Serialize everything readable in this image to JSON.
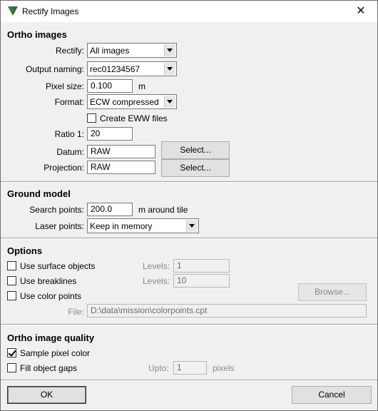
{
  "window": {
    "title": "Rectify Images",
    "close_icon": "close-icon"
  },
  "ortho": {
    "heading": "Ortho images",
    "rectify_label": "Rectify:",
    "rectify_value": "All images",
    "output_naming_label": "Output naming:",
    "output_naming_value": "rec01234567",
    "pixel_size_label": "Pixel size:",
    "pixel_size_value": "0.100",
    "pixel_size_unit": "m",
    "format_label": "Format:",
    "format_value": "ECW compressed",
    "create_eww_label": "Create EWW files",
    "create_eww_checked": false,
    "ratio_label": "Ratio 1:",
    "ratio_value": "20",
    "datum_label": "Datum:",
    "datum_value": "RAW",
    "datum_button": "Select...",
    "projection_label": "Projection:",
    "projection_value": "RAW",
    "projection_button": "Select..."
  },
  "ground": {
    "heading": "Ground model",
    "search_points_label": "Search points:",
    "search_points_value": "200.0",
    "search_points_unit": "m around tile",
    "laser_points_label": "Laser points:",
    "laser_points_value": "Keep in memory"
  },
  "options": {
    "heading": "Options",
    "surface_objects_label": "Use surface objects",
    "surface_objects_checked": false,
    "surface_levels_label": "Levels:",
    "surface_levels_value": "1",
    "breaklines_label": "Use breaklines",
    "breaklines_checked": false,
    "breaklines_levels_label": "Levels:",
    "breaklines_levels_value": "10",
    "color_points_label": "Use color points",
    "color_points_checked": false,
    "browse_button": "Browse...",
    "file_label": "File:",
    "file_value": "D:\\data\\mission\\colorpoints.cpt"
  },
  "quality": {
    "heading": "Ortho image quality",
    "sample_pixel_label": "Sample pixel color",
    "sample_pixel_checked": true,
    "fill_gaps_label": "Fill object gaps",
    "fill_gaps_checked": false,
    "upto_label": "Upto:",
    "upto_value": "1",
    "upto_unit": "pixels"
  },
  "footer": {
    "ok_label": "OK",
    "cancel_label": "Cancel"
  }
}
